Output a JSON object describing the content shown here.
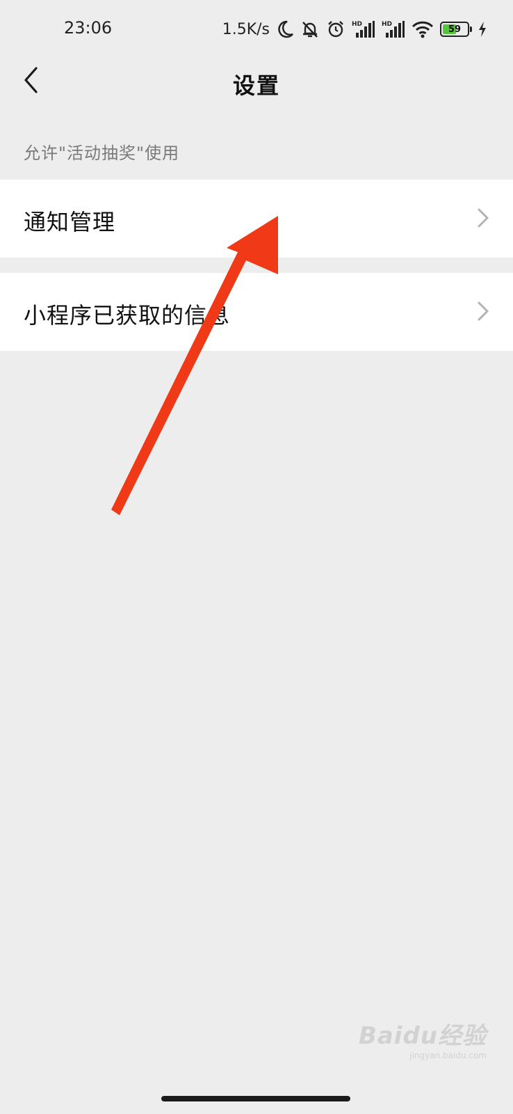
{
  "status_bar": {
    "time": "23:06",
    "net_speed": "1.5K/s",
    "icons": [
      "moon-icon",
      "bell-off-icon",
      "alarm-icon",
      "signal-hd-icon",
      "signal-hd-icon",
      "wifi-icon",
      "battery-icon",
      "charging-icon"
    ],
    "battery_level": "59",
    "battery_fraction": 0.59,
    "battery_color": "#56c53b"
  },
  "nav": {
    "title": "设置",
    "back_icon": "chevron-left-icon"
  },
  "section": {
    "header": "允许\"活动抽奖\"使用"
  },
  "items": [
    {
      "label": "通知管理",
      "icon": "chevron-right-icon"
    },
    {
      "label": "小程序已获取的信息",
      "icon": "chevron-right-icon"
    }
  ],
  "annotation": {
    "type": "arrow",
    "color": "#f03a17",
    "points_to": "通知管理"
  },
  "watermark": {
    "brand": "Baidu经验",
    "url": "jingyan.baidu.com"
  },
  "colors": {
    "background": "#ededed",
    "card": "#ffffff",
    "section_text": "#7a7a7a",
    "chevron": "#b2b2b2"
  }
}
